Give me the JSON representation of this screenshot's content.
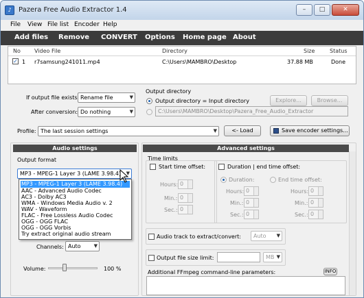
{
  "window": {
    "title": "Pazera Free Audio Extractor 1.4",
    "icon_glyph": "♪",
    "minimize": "–",
    "maximize": "□",
    "close": "✕"
  },
  "menu": [
    "File",
    "View",
    "File list",
    "Encoder",
    "Help"
  ],
  "toolbar": [
    "Add files",
    "Remove",
    "CONVERT",
    "Options",
    "Home page",
    "About"
  ],
  "file_list": {
    "headers": {
      "no": "No",
      "video": "Video File",
      "directory": "Directory",
      "size": "Size",
      "status": "Status"
    },
    "rows": [
      {
        "checked": "✓",
        "no": "1",
        "video": "r7samsung241011.mp4",
        "directory": "C:\\Users\\MAMBRO\\Desktop",
        "size": "37.88 MB",
        "status": "Done"
      }
    ]
  },
  "options": {
    "if_exists_label": "If output file exists:",
    "if_exists_value": "Rename file",
    "after_conversion_label": "After conversion:",
    "after_conversion_value": "Do nothing",
    "output_dir_title": "Output directory",
    "output_eq_input": "Output directory = Input directory",
    "custom_dir": "C:\\Users\\MAMBRO\\Desktop\\Pazera_Free_Audio_Extractor",
    "explore": "Explore...",
    "browse": "Browse..."
  },
  "profile": {
    "label": "Profile:",
    "value": "The last session settings",
    "load": "<- Load",
    "save": "Save encoder settings..."
  },
  "audio": {
    "title": "Audio settings",
    "output_format_label": "Output format",
    "selected_format": "MP3 - MPEG-1 Layer 3 (LAME 3.98.4)",
    "format_options": [
      "MP3 - MPEG-1 Layer 3 (LAME 3.98.4)",
      "AAC - Advanced Audio Codec",
      "AC3 - Dolby AC3",
      "WMA - Windows Media Audio v. 2",
      "WAV - Waveform",
      "FLAC - Free Lossless Audio Codec",
      "OGG - OGG FLAC",
      "OGG - OGG Vorbis",
      "Try extract original audio stream"
    ],
    "partial_letter": "A",
    "channels_label": "Channels:",
    "channels_value": "Auto",
    "volume_label": "Volume:",
    "volume_value": "100 %",
    "volume_level": 0.33
  },
  "advanced": {
    "title": "Advanced settings",
    "time_limits": "Time limits",
    "start_offset": "Start time offset:",
    "duration_end": "Duration | end time offset:",
    "hours": "Hours:",
    "min": "Min.:",
    "sec": "Sec.:",
    "zero": "0",
    "duration": "Duration:",
    "end_offset": "End time offset:",
    "audio_track": "Audio track to extract/convert:",
    "audio_track_value": "Auto",
    "size_limit": "Output file size limit:",
    "size_unit": "MB",
    "ffmpeg_params": "Additional FFmpeg command-line parameters:",
    "info": "INFO"
  }
}
